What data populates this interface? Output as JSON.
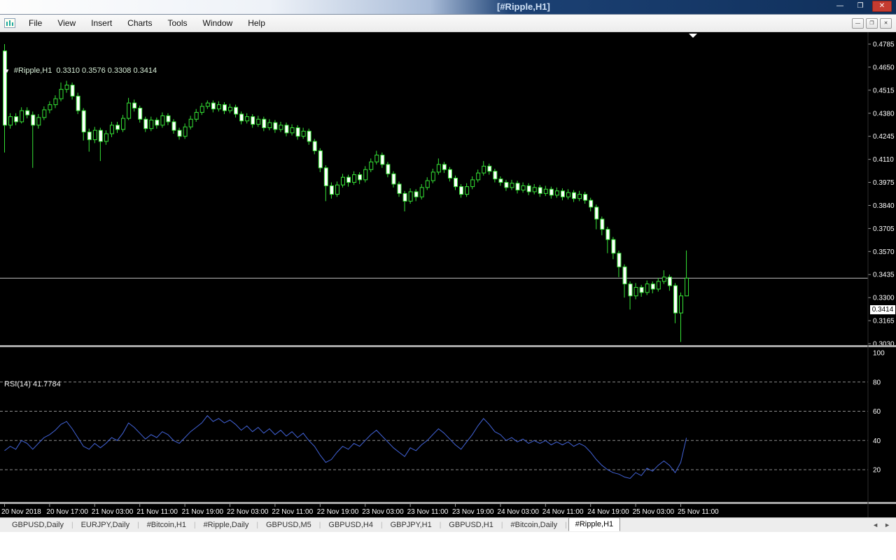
{
  "window": {
    "title": "[#Ripple,H1]",
    "controls": {
      "minimize": "—",
      "maximize": "❐",
      "close": "✕"
    }
  },
  "menu": {
    "items": [
      "File",
      "View",
      "Insert",
      "Charts",
      "Tools",
      "Window",
      "Help"
    ]
  },
  "chart": {
    "symbol_marker": "▼",
    "symbol_label": "#Ripple,H1",
    "ohlc_label": "0.3310 0.3576 0.3308 0.3414",
    "rsi_label": "RSI(14) 41.7784",
    "current_price": "0.3414"
  },
  "tabs": {
    "items": [
      "GBPUSD,Daily",
      "EURJPY,Daily",
      "#Bitcoin,H1",
      "#Ripple,Daily",
      "GBPUSD,M5",
      "GBPUSD,H4",
      "GBPJPY,H1",
      "GBPUSD,H1",
      "#Bitcoin,Daily",
      "#Ripple,H1"
    ],
    "active": "#Ripple,H1",
    "separator": "|",
    "scroll_left": "◄",
    "scroll_right": "►"
  },
  "chart_data": {
    "type": "candlestick",
    "symbol": "#Ripple,H1",
    "timeframe": "H1",
    "current_price": 0.3414,
    "price_axis_range": [
      0.303,
      0.4785
    ],
    "price_ticks": [
      "0.4785",
      "0.4650",
      "0.4515",
      "0.4380",
      "0.4245",
      "0.4110",
      "0.3975",
      "0.3840",
      "0.3705",
      "0.3570",
      "0.3435",
      "0.3300",
      "0.3165",
      "0.3030"
    ],
    "time_labels": [
      {
        "index": 0,
        "label": "20 Nov 2018"
      },
      {
        "index": 8,
        "label": "20 Nov 17:00"
      },
      {
        "index": 16,
        "label": "21 Nov 03:00"
      },
      {
        "index": 24,
        "label": "21 Nov 11:00"
      },
      {
        "index": 32,
        "label": "21 Nov 19:00"
      },
      {
        "index": 40,
        "label": "22 Nov 03:00"
      },
      {
        "index": 48,
        "label": "22 Nov 11:00"
      },
      {
        "index": 56,
        "label": "22 Nov 19:00"
      },
      {
        "index": 64,
        "label": "23 Nov 03:00"
      },
      {
        "index": 72,
        "label": "23 Nov 11:00"
      },
      {
        "index": 80,
        "label": "23 Nov 19:00"
      },
      {
        "index": 88,
        "label": "24 Nov 03:00"
      },
      {
        "index": 96,
        "label": "24 Nov 11:00"
      },
      {
        "index": 104,
        "label": "24 Nov 19:00"
      },
      {
        "index": 112,
        "label": "25 Nov 03:00"
      },
      {
        "index": 120,
        "label": "25 Nov 11:00"
      }
    ],
    "candles": [
      [
        0.4745,
        0.4785,
        0.415,
        0.431
      ],
      [
        0.431,
        0.438,
        0.429,
        0.436
      ],
      [
        0.436,
        0.438,
        0.431,
        0.433
      ],
      [
        0.433,
        0.4415,
        0.432,
        0.4395
      ],
      [
        0.4395,
        0.4415,
        0.435,
        0.437
      ],
      [
        0.437,
        0.439,
        0.406,
        0.431
      ],
      [
        0.431,
        0.4375,
        0.429,
        0.4355
      ],
      [
        0.4355,
        0.442,
        0.434,
        0.44
      ],
      [
        0.44,
        0.445,
        0.438,
        0.443
      ],
      [
        0.443,
        0.4485,
        0.441,
        0.4465
      ],
      [
        0.4465,
        0.456,
        0.445,
        0.452
      ],
      [
        0.452,
        0.457,
        0.45,
        0.4545
      ],
      [
        0.4545,
        0.456,
        0.446,
        0.448
      ],
      [
        0.448,
        0.45,
        0.4375,
        0.4395
      ],
      [
        0.4395,
        0.441,
        0.422,
        0.427
      ],
      [
        0.427,
        0.429,
        0.4155,
        0.4225
      ],
      [
        0.4225,
        0.43,
        0.4205,
        0.428
      ],
      [
        0.428,
        0.4295,
        0.41,
        0.4215
      ],
      [
        0.4215,
        0.428,
        0.4195,
        0.426
      ],
      [
        0.426,
        0.433,
        0.424,
        0.431
      ],
      [
        0.431,
        0.433,
        0.4265,
        0.4285
      ],
      [
        0.4285,
        0.437,
        0.427,
        0.435
      ],
      [
        0.435,
        0.447,
        0.434,
        0.444
      ],
      [
        0.444,
        0.446,
        0.439,
        0.441
      ],
      [
        0.441,
        0.4425,
        0.4325,
        0.4345
      ],
      [
        0.4345,
        0.436,
        0.427,
        0.429
      ],
      [
        0.429,
        0.436,
        0.4275,
        0.434
      ],
      [
        0.434,
        0.4355,
        0.429,
        0.431
      ],
      [
        0.431,
        0.4385,
        0.4295,
        0.4365
      ],
      [
        0.4365,
        0.438,
        0.431,
        0.433
      ],
      [
        0.433,
        0.4345,
        0.426,
        0.428
      ],
      [
        0.428,
        0.4295,
        0.4225,
        0.4245
      ],
      [
        0.4245,
        0.432,
        0.423,
        0.43
      ],
      [
        0.43,
        0.4365,
        0.4285,
        0.4345
      ],
      [
        0.4345,
        0.4405,
        0.433,
        0.4385
      ],
      [
        0.4385,
        0.444,
        0.437,
        0.442
      ],
      [
        0.442,
        0.4455,
        0.4405,
        0.444
      ],
      [
        0.444,
        0.4455,
        0.4385,
        0.4405
      ],
      [
        0.4405,
        0.445,
        0.439,
        0.443
      ],
      [
        0.443,
        0.4445,
        0.4375,
        0.4395
      ],
      [
        0.4395,
        0.4435,
        0.438,
        0.4415
      ],
      [
        0.4415,
        0.443,
        0.4355,
        0.4375
      ],
      [
        0.4375,
        0.439,
        0.4315,
        0.4335
      ],
      [
        0.4335,
        0.438,
        0.432,
        0.436
      ],
      [
        0.436,
        0.4375,
        0.4295,
        0.4315
      ],
      [
        0.4315,
        0.4365,
        0.43,
        0.4345
      ],
      [
        0.4345,
        0.436,
        0.4275,
        0.4295
      ],
      [
        0.4295,
        0.4345,
        0.428,
        0.4325
      ],
      [
        0.4325,
        0.434,
        0.4265,
        0.4285
      ],
      [
        0.4285,
        0.433,
        0.427,
        0.431
      ],
      [
        0.431,
        0.4325,
        0.4245,
        0.4265
      ],
      [
        0.4265,
        0.4315,
        0.425,
        0.4295
      ],
      [
        0.4295,
        0.431,
        0.4225,
        0.4245
      ],
      [
        0.4245,
        0.4295,
        0.423,
        0.4275
      ],
      [
        0.4275,
        0.429,
        0.4195,
        0.4215
      ],
      [
        0.4215,
        0.423,
        0.414,
        0.416
      ],
      [
        0.416,
        0.4175,
        0.4035,
        0.406
      ],
      [
        0.406,
        0.4075,
        0.3865,
        0.3955
      ],
      [
        0.3955,
        0.3975,
        0.388,
        0.3905
      ],
      [
        0.3905,
        0.398,
        0.389,
        0.396
      ],
      [
        0.396,
        0.4025,
        0.3945,
        0.4005
      ],
      [
        0.4005,
        0.402,
        0.395,
        0.3975
      ],
      [
        0.3975,
        0.404,
        0.396,
        0.402
      ],
      [
        0.402,
        0.4035,
        0.3965,
        0.399
      ],
      [
        0.399,
        0.407,
        0.3975,
        0.405
      ],
      [
        0.405,
        0.4115,
        0.4035,
        0.4095
      ],
      [
        0.4095,
        0.416,
        0.408,
        0.4135
      ],
      [
        0.4135,
        0.415,
        0.406,
        0.408
      ],
      [
        0.408,
        0.4095,
        0.4005,
        0.4025
      ],
      [
        0.4025,
        0.404,
        0.3945,
        0.3965
      ],
      [
        0.3965,
        0.398,
        0.389,
        0.391
      ],
      [
        0.391,
        0.3925,
        0.3805,
        0.3865
      ],
      [
        0.3865,
        0.394,
        0.385,
        0.392
      ],
      [
        0.392,
        0.3935,
        0.3865,
        0.389
      ],
      [
        0.389,
        0.3965,
        0.3875,
        0.3945
      ],
      [
        0.3945,
        0.4005,
        0.393,
        0.3985
      ],
      [
        0.3985,
        0.4055,
        0.397,
        0.4035
      ],
      [
        0.4035,
        0.4115,
        0.402,
        0.408
      ],
      [
        0.408,
        0.4095,
        0.403,
        0.405
      ],
      [
        0.405,
        0.4065,
        0.398,
        0.4
      ],
      [
        0.4,
        0.4015,
        0.393,
        0.395
      ],
      [
        0.395,
        0.3965,
        0.3885,
        0.3905
      ],
      [
        0.3905,
        0.397,
        0.389,
        0.395
      ],
      [
        0.395,
        0.401,
        0.3935,
        0.399
      ],
      [
        0.399,
        0.405,
        0.3975,
        0.403
      ],
      [
        0.403,
        0.41,
        0.4015,
        0.407
      ],
      [
        0.407,
        0.4085,
        0.402,
        0.404
      ],
      [
        0.404,
        0.4055,
        0.3975,
        0.3995
      ],
      [
        0.3995,
        0.401,
        0.3955,
        0.3975
      ],
      [
        0.3975,
        0.399,
        0.3925,
        0.3945
      ],
      [
        0.3945,
        0.399,
        0.393,
        0.397
      ],
      [
        0.397,
        0.3985,
        0.391,
        0.393
      ],
      [
        0.393,
        0.3975,
        0.3915,
        0.3955
      ],
      [
        0.3955,
        0.397,
        0.39,
        0.392
      ],
      [
        0.392,
        0.3965,
        0.3905,
        0.3945
      ],
      [
        0.3945,
        0.396,
        0.389,
        0.391
      ],
      [
        0.391,
        0.3955,
        0.3895,
        0.3935
      ],
      [
        0.3935,
        0.395,
        0.388,
        0.39
      ],
      [
        0.39,
        0.3945,
        0.3885,
        0.3925
      ],
      [
        0.3925,
        0.394,
        0.387,
        0.389
      ],
      [
        0.389,
        0.3935,
        0.3875,
        0.3915
      ],
      [
        0.3915,
        0.393,
        0.386,
        0.388
      ],
      [
        0.388,
        0.3925,
        0.3865,
        0.3905
      ],
      [
        0.3905,
        0.392,
        0.385,
        0.387
      ],
      [
        0.387,
        0.3885,
        0.3805,
        0.383
      ],
      [
        0.383,
        0.3845,
        0.37,
        0.376
      ],
      [
        0.376,
        0.3775,
        0.3665,
        0.37
      ],
      [
        0.37,
        0.3715,
        0.356,
        0.364
      ],
      [
        0.364,
        0.3655,
        0.3525,
        0.356
      ],
      [
        0.356,
        0.3575,
        0.342,
        0.348
      ],
      [
        0.348,
        0.3495,
        0.33,
        0.338
      ],
      [
        0.338,
        0.3395,
        0.323,
        0.331
      ],
      [
        0.331,
        0.3385,
        0.329,
        0.336
      ],
      [
        0.336,
        0.3375,
        0.3305,
        0.333
      ],
      [
        0.333,
        0.34,
        0.3315,
        0.338
      ],
      [
        0.338,
        0.3395,
        0.3325,
        0.335
      ],
      [
        0.335,
        0.3415,
        0.3335,
        0.3395
      ],
      [
        0.3395,
        0.346,
        0.338,
        0.342
      ],
      [
        0.342,
        0.3435,
        0.334,
        0.337
      ],
      [
        0.337,
        0.3385,
        0.315,
        0.321
      ],
      [
        0.321,
        0.333,
        0.304,
        0.331
      ],
      [
        0.331,
        0.3576,
        0.3308,
        0.3414
      ]
    ],
    "rsi": {
      "period": 14,
      "current": 41.7784,
      "levels": [
        80,
        60,
        40,
        20
      ],
      "axis_ticks": [
        "100",
        "80",
        "60",
        "40",
        "20"
      ],
      "values": [
        33,
        36,
        34,
        40,
        38,
        34,
        38,
        42,
        44,
        47,
        51,
        53,
        48,
        42,
        36,
        34,
        38,
        35,
        38,
        42,
        40,
        45,
        52,
        49,
        45,
        41,
        44,
        42,
        46,
        44,
        40,
        38,
        42,
        46,
        49,
        52,
        57,
        53,
        55,
        52,
        54,
        51,
        47,
        50,
        46,
        49,
        45,
        48,
        44,
        47,
        43,
        46,
        42,
        45,
        40,
        36,
        30,
        25,
        27,
        32,
        36,
        34,
        38,
        36,
        40,
        44,
        47,
        43,
        39,
        35,
        32,
        29,
        35,
        33,
        37,
        40,
        44,
        48,
        45,
        41,
        37,
        34,
        39,
        44,
        50,
        55,
        51,
        46,
        44,
        40,
        42,
        39,
        41,
        38,
        40,
        38,
        40,
        37,
        39,
        37,
        39,
        36,
        38,
        36,
        32,
        27,
        23,
        20,
        18,
        17,
        15,
        14,
        18,
        16,
        21,
        19,
        23,
        26,
        23,
        18,
        25,
        41.7784
      ]
    },
    "colors": {
      "up_fill": "#000000",
      "down_fill": "#ffffff",
      "outline": "#35e335",
      "wick": "#35e335",
      "rsi": "#4263d8",
      "level": "#8c8c8c",
      "price_line": "#bdbdbd",
      "background": "#000000",
      "text": "#ffffff"
    }
  }
}
